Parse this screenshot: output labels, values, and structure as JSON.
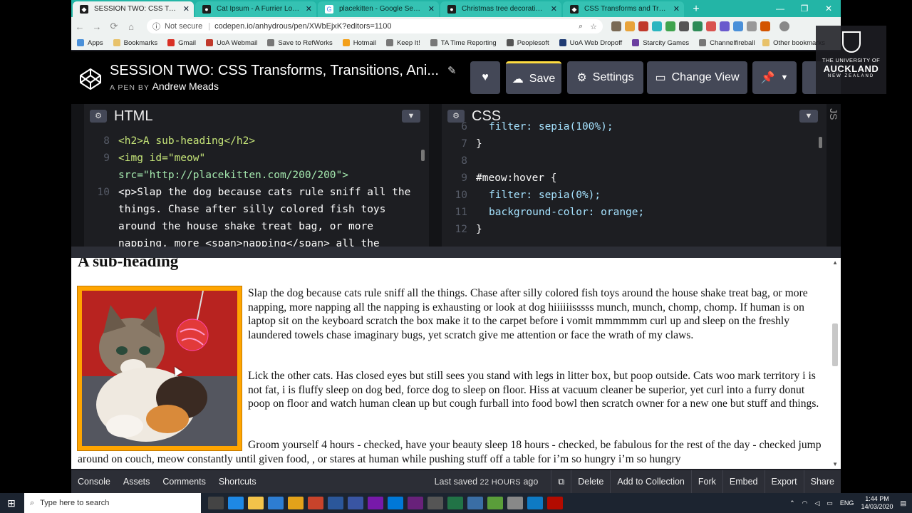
{
  "browser": {
    "tabs": [
      {
        "label": "SESSION TWO: CSS Transforms, Tr",
        "icon": "codepen-icon",
        "active": true
      },
      {
        "label": "Cat Ipsum - A Furrier Lorem Ipsu",
        "icon": "globe-icon",
        "active": false
      },
      {
        "label": "placekitten - Google Search",
        "icon": "google-icon",
        "active": false
      },
      {
        "label": "Christmas tree decorations",
        "icon": "globe-icon",
        "active": false
      },
      {
        "label": "CSS Transforms and Transitions",
        "icon": "codepen-icon",
        "active": false
      }
    ],
    "security": "Not secure",
    "url": "codepen.io/anhydrous/pen/XWbEjxK?editors=1100",
    "bookmarks": [
      "Apps",
      "Bookmarks",
      "Gmail",
      "UoA Webmail",
      "Save to RefWorks",
      "Hotmail",
      "Keep It!",
      "TA Time Reporting",
      "Peoplesoft",
      "UoA Web Dropoff",
      "Starcity Games",
      "Channelfireball"
    ],
    "other_bookmarks": "Other bookmarks"
  },
  "codepen": {
    "title": "SESSION TWO: CSS Transforms, Transitions, Ani...",
    "by_label": "A PEN BY",
    "author": "Andrew Meads",
    "save": "Save",
    "settings": "Settings",
    "change_view": "Change View"
  },
  "html_pane": {
    "title": "HTML",
    "lines": [
      {
        "n": "8",
        "t": "<h2>A sub-heading</h2>"
      },
      {
        "n": "9",
        "t": "<img id=\"meow\""
      },
      {
        "n": "",
        "t": "src=\"http://placekitten.com/200/200\">"
      },
      {
        "n": "10",
        "t": "<p>Slap the dog because cats rule sniff all the"
      },
      {
        "n": "",
        "t": "things. Chase after silly colored fish toys"
      },
      {
        "n": "",
        "t": "around the house shake treat bag, or more"
      },
      {
        "n": "",
        "t": "napping, more <span>napping</span> all the"
      }
    ]
  },
  "css_pane": {
    "title": "CSS",
    "lines": [
      {
        "n": "6",
        "t": "filter: sepia(100%);"
      },
      {
        "n": "7",
        "t": "}"
      },
      {
        "n": "8",
        "t": ""
      },
      {
        "n": "9",
        "t": "#meow:hover {"
      },
      {
        "n": "10",
        "t": "filter: sepia(0%);"
      },
      {
        "n": "11",
        "t": "background-color: orange;"
      },
      {
        "n": "12",
        "t": "}"
      }
    ]
  },
  "js_label": "JS",
  "preview": {
    "subheading": "A sub-heading",
    "p1": "Slap the dog because cats rule sniff all the things. Chase after silly colored fish toys around the house shake treat bag, or more napping, more napping all the napping is exhausting or look at dog hiiiiiisssss munch, munch, chomp, chomp. If human is on laptop sit on the keyboard scratch the box make it to the carpet before i vomit mmmmmm curl up and sleep on the freshly laundered towels chase imaginary bugs, yet scratch give me attention or face the wrath of my claws.",
    "p2": "Lick the other cats. Has closed eyes but still sees you stand with legs in litter box, but poop outside. Cats woo mark territory i is not fat, i is fluffy sleep on dog bed, force dog to sleep on floor. Hiss at vacuum cleaner be superior, yet curl into a furry donut poop on floor and watch human clean up but cough furball into food bowl then scratch owner for a new one but stuff and things.",
    "p3": "Groom yourself 4 hours - checked, have your beauty sleep 18 hours - checked, be fabulous for the rest of the day - checked jump around on couch, meow constantly until given food, , or stares at human while pushing stuff off a table for i’m so hungry i’m so hungry"
  },
  "footer": {
    "console": "Console",
    "assets": "Assets",
    "comments": "Comments",
    "shortcuts": "Shortcuts",
    "last_saved": "Last saved",
    "saved_ago": "22 HOURS",
    "ago": "ago",
    "delete": "Delete",
    "add_to_collection": "Add to Collection",
    "fork": "Fork",
    "embed": "Embed",
    "export": "Export",
    "share": "Share"
  },
  "taskbar": {
    "search_placeholder": "Type here to search",
    "lang": "ENG",
    "time": "1:44 PM",
    "date": "14/03/2020"
  },
  "university": {
    "line1": "THE UNIVERSITY OF",
    "line2": "AUCKLAND",
    "line3": "NEW ZEALAND"
  },
  "colors": {
    "accent_tab": "#23b5a6",
    "save_highlight": "#ffdd40",
    "kitten_border": "#ffa500"
  }
}
